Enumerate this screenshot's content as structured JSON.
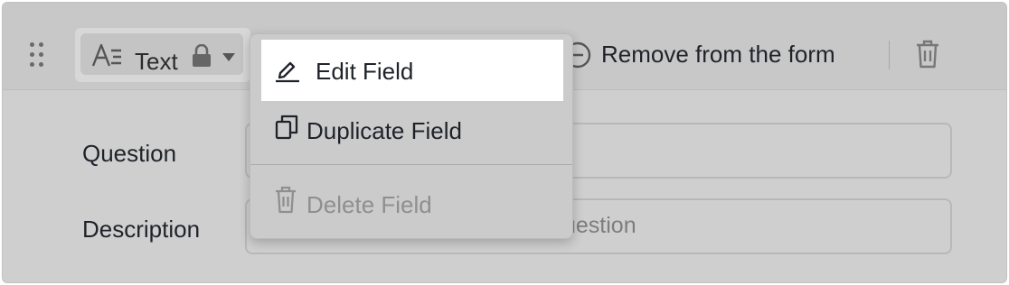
{
  "toolbar": {
    "field_type_label": "Text",
    "remove_label": "Remove from the form"
  },
  "form": {
    "question_label": "Question",
    "description_label": "Description",
    "description_placeholder_visible": "uestion"
  },
  "menu": {
    "items": [
      {
        "label": "Edit Field",
        "icon": "edit-icon",
        "highlighted": true,
        "disabled": false
      },
      {
        "label": "Duplicate Field",
        "icon": "copy-icon",
        "highlighted": false,
        "disabled": false
      },
      {
        "label": "Delete Field",
        "icon": "trash-icon",
        "highlighted": false,
        "disabled": true
      }
    ]
  },
  "colors": {
    "overlay": "#cfcfcf",
    "highlight": "#ffffff",
    "text": "#1f2329",
    "disabled_text": "#8f8f8f"
  }
}
